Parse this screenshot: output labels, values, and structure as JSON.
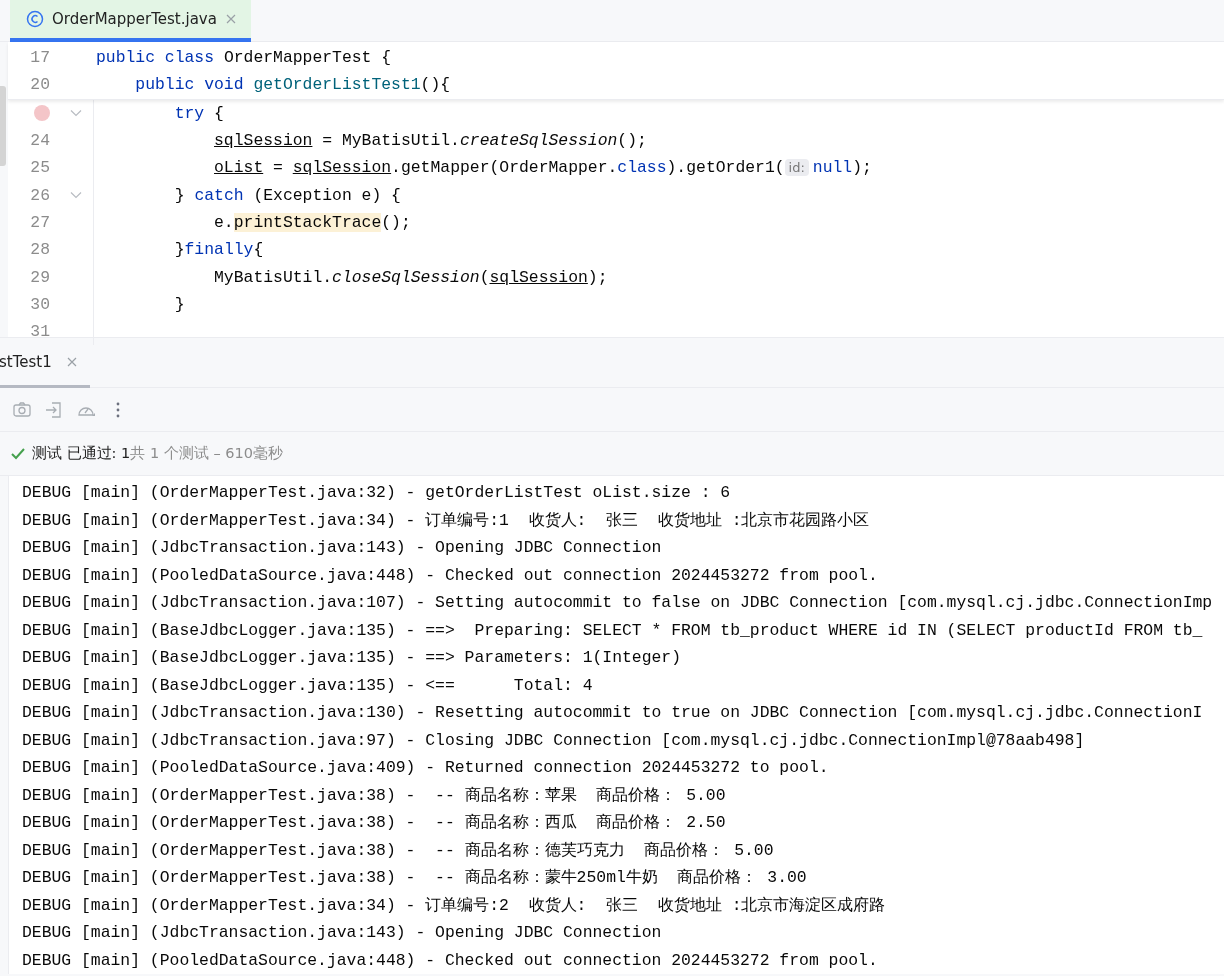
{
  "editor_tab": {
    "label": "OrderMapperTest.java",
    "selected": true
  },
  "editor": {
    "sticky_lines": [
      {
        "number": "17",
        "segments": [
          {
            "kind": "keyword",
            "text": "public class "
          },
          {
            "kind": "plain",
            "text": "OrderMapperTest {"
          }
        ]
      },
      {
        "number": "20",
        "segments": [
          {
            "kind": "keyword",
            "text": "    public void "
          },
          {
            "kind": "method",
            "text": "getOrderListTest1"
          },
          {
            "kind": "plain",
            "text": "(){"
          }
        ]
      }
    ],
    "lines": [
      {
        "breakpoint": true,
        "foldable": true,
        "segments": [
          {
            "kind": "keyword",
            "text": "try "
          },
          {
            "kind": "plain",
            "text": "{"
          }
        ],
        "children": [
          {
            "number": "24",
            "breakpoint": false,
            "foldable": false,
            "segments": [
              {
                "kind": "underline",
                "text": "sqlSession"
              },
              {
                "kind": "plain",
                "text": " = MyBatisUtil."
              },
              {
                "kind": "italic",
                "text": "createSqlSession"
              },
              {
                "kind": "plain",
                "text": "();"
              }
            ]
          },
          {
            "number": "25",
            "breakpoint": false,
            "foldable": false,
            "segments": [
              {
                "kind": "underline",
                "text": "oList"
              },
              {
                "kind": "plain",
                "text": " = "
              },
              {
                "kind": "underline",
                "text": "sqlSession"
              },
              {
                "kind": "plain",
                "text": ".getMapper(OrderMapper."
              },
              {
                "kind": "keyword",
                "text": "class"
              },
              {
                "kind": "plain",
                "text": ").getOrder1("
              },
              {
                "kind": "hint",
                "text": "id:"
              },
              {
                "kind": "keyword",
                "text": "null"
              },
              {
                "kind": "plain",
                "text": ");"
              }
            ]
          }
        ]
      },
      {
        "number": "26",
        "breakpoint": false,
        "foldable": true,
        "segments": [
          {
            "kind": "plain",
            "text": "} "
          },
          {
            "kind": "keyword",
            "text": "catch"
          },
          {
            "kind": "plain",
            "text": " (Exception e) {"
          }
        ],
        "children": [
          {
            "number": "27",
            "breakpoint": false,
            "foldable": false,
            "segments": [
              {
                "kind": "plain",
                "text": "e."
              },
              {
                "kind": "highlight",
                "text": "printStackTrace"
              },
              {
                "kind": "plain",
                "text": "();"
              }
            ]
          }
        ]
      },
      {
        "number": "28",
        "breakpoint": false,
        "foldable": false,
        "segments": [
          {
            "kind": "plain",
            "text": "}"
          },
          {
            "kind": "keyword",
            "text": "finally"
          },
          {
            "kind": "plain",
            "text": "{"
          }
        ],
        "children": [
          {
            "number": "29",
            "breakpoint": false,
            "foldable": false,
            "segments": [
              {
                "kind": "plain",
                "text": "MyBatisUtil."
              },
              {
                "kind": "italic",
                "text": "closeSqlSession"
              },
              {
                "kind": "plain",
                "text": "("
              },
              {
                "kind": "underline",
                "text": "sqlSession"
              },
              {
                "kind": "plain",
                "text": ");"
              }
            ]
          }
        ]
      },
      {
        "number": "30",
        "breakpoint": false,
        "foldable": false,
        "segments": [
          {
            "kind": "plain",
            "text": "}"
          }
        ]
      },
      {
        "number": "31",
        "breakpoint": false,
        "foldable": false
      }
    ]
  },
  "run_panel": {
    "tab": {
      "label": "stTest1",
      "selected": true
    },
    "toolbar": [
      {
        "kind": "camera"
      },
      {
        "kind": "import"
      },
      {
        "kind": "gauge"
      },
      {
        "kind": "more"
      }
    ],
    "status": {
      "passed": true,
      "label": "测试 已通过: 1",
      "summary": "共 1 个测试 – 610毫秒"
    },
    "log": [
      "DEBUG [main] (OrderMapperTest.java:32) - getOrderListTest oList.size : 6",
      "DEBUG [main] (OrderMapperTest.java:34) - 订单编号:1  收货人:  张三  收货地址 :北京市花园路小区",
      "DEBUG [main] (JdbcTransaction.java:143) - Opening JDBC Connection",
      "DEBUG [main] (PooledDataSource.java:448) - Checked out connection 2024453272 from pool.",
      "DEBUG [main] (JdbcTransaction.java:107) - Setting autocommit to false on JDBC Connection [com.mysql.cj.jdbc.ConnectionImp",
      "DEBUG [main] (BaseJdbcLogger.java:135) - ==>  Preparing: SELECT * FROM tb_product WHERE id IN (SELECT productId FROM tb_",
      "DEBUG [main] (BaseJdbcLogger.java:135) - ==> Parameters: 1(Integer)",
      "DEBUG [main] (BaseJdbcLogger.java:135) - <==      Total: 4",
      "DEBUG [main] (JdbcTransaction.java:130) - Resetting autocommit to true on JDBC Connection [com.mysql.cj.jdbc.ConnectionI",
      "DEBUG [main] (JdbcTransaction.java:97) - Closing JDBC Connection [com.mysql.cj.jdbc.ConnectionImpl@78aab498]",
      "DEBUG [main] (PooledDataSource.java:409) - Returned connection 2024453272 to pool.",
      "DEBUG [main] (OrderMapperTest.java:38) -  -- 商品名称：苹果  商品价格： 5.00",
      "DEBUG [main] (OrderMapperTest.java:38) -  -- 商品名称：西瓜  商品价格： 2.50",
      "DEBUG [main] (OrderMapperTest.java:38) -  -- 商品名称：德芙巧克力  商品价格： 5.00",
      "DEBUG [main] (OrderMapperTest.java:38) -  -- 商品名称：蒙牛250ml牛奶  商品价格： 3.00",
      "DEBUG [main] (OrderMapperTest.java:34) - 订单编号:2  收货人:  张三  收货地址 :北京市海淀区成府路",
      "DEBUG [main] (JdbcTransaction.java:143) - Opening JDBC Connection",
      "DEBUG [main] (PooledDataSource.java:448) - Checked out connection 2024453272 from pool."
    ]
  }
}
